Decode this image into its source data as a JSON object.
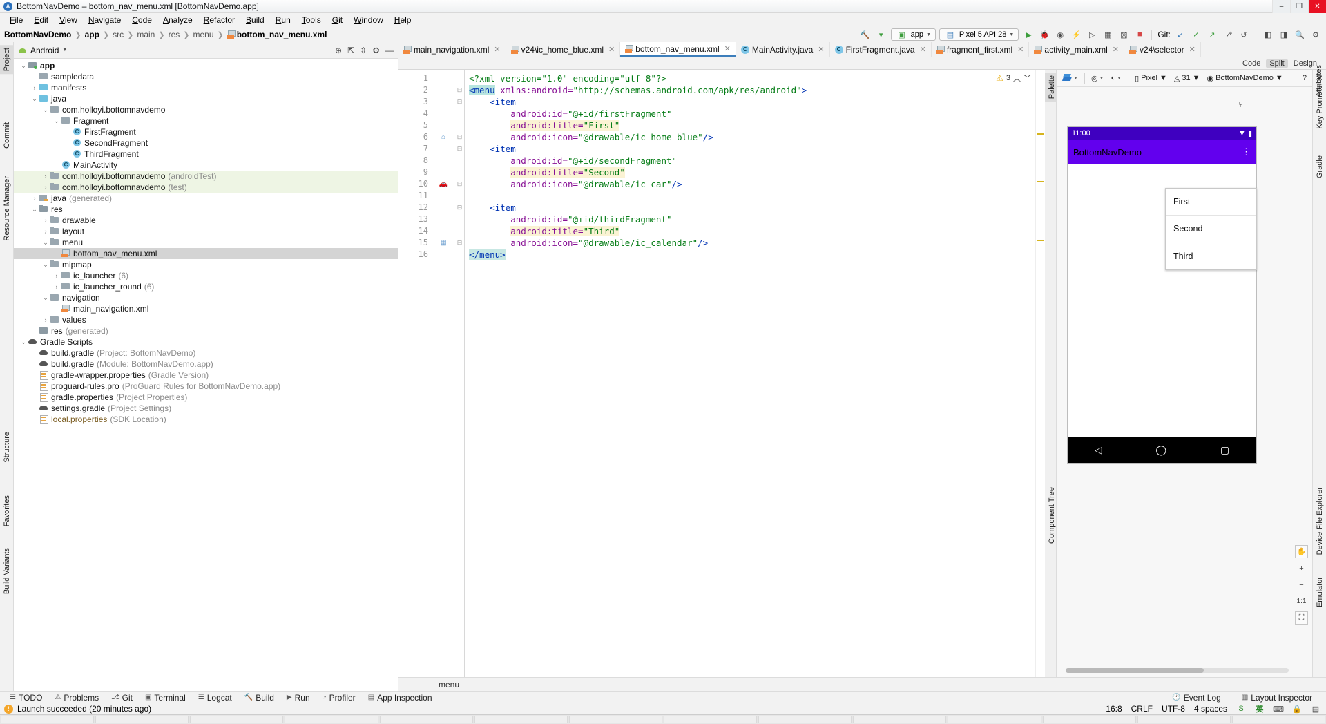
{
  "window": {
    "title": "BottomNavDemo – bottom_nav_menu.xml [BottomNavDemo.app]",
    "app_icon": "android-studio-icon",
    "minimize": "–",
    "maximize": "❐",
    "close": "✕"
  },
  "menubar": [
    "File",
    "Edit",
    "View",
    "Navigate",
    "Code",
    "Analyze",
    "Refactor",
    "Build",
    "Run",
    "Tools",
    "Git",
    "Window",
    "Help"
  ],
  "breadcrumb": {
    "project": "BottomNavDemo",
    "items": [
      "app",
      "src",
      "main",
      "res",
      "menu"
    ],
    "file": "bottom_nav_menu.xml"
  },
  "main_toolbar": {
    "module_selector": "app",
    "device_selector": "Pixel 5 API 28",
    "git_label": "Git:",
    "icons": [
      "build-hammer-icon",
      "run-icon",
      "debug-icon",
      "profile-icon",
      "attach-debugger-icon",
      "sdk-manager-icon",
      "avd-manager-icon",
      "stop-icon",
      "check-icon",
      "update-icon",
      "push-icon",
      "history-icon",
      "search-everywhere-icon",
      "settings-icon"
    ]
  },
  "project_panel": {
    "header_title": "Android",
    "header_icons": [
      "locate-icon",
      "collapse-all-icon",
      "filter-icon",
      "settings-icon",
      "hide-icon"
    ],
    "tree": [
      {
        "depth": 0,
        "arrow": "v",
        "icon": "app",
        "label": "app",
        "suffix": "",
        "bold": true
      },
      {
        "depth": 1,
        "arrow": "",
        "icon": "folder",
        "label": "sampledata",
        "suffix": ""
      },
      {
        "depth": 1,
        "arrow": ">",
        "icon": "folderb",
        "label": "manifests",
        "suffix": ""
      },
      {
        "depth": 1,
        "arrow": "v",
        "icon": "folderb",
        "label": "java",
        "suffix": ""
      },
      {
        "depth": 2,
        "arrow": "v",
        "icon": "folder",
        "label": "com.holloyi.bottomnavdemo",
        "suffix": ""
      },
      {
        "depth": 3,
        "arrow": "v",
        "icon": "folder",
        "label": "Fragment",
        "suffix": ""
      },
      {
        "depth": 4,
        "arrow": "",
        "icon": "cls",
        "label": "FirstFragment",
        "suffix": ""
      },
      {
        "depth": 4,
        "arrow": "",
        "icon": "cls",
        "label": "SecondFragment",
        "suffix": ""
      },
      {
        "depth": 4,
        "arrow": "",
        "icon": "cls",
        "label": "ThirdFragment",
        "suffix": ""
      },
      {
        "depth": 3,
        "arrow": "",
        "icon": "cls",
        "label": "MainActivity",
        "suffix": ""
      },
      {
        "depth": 2,
        "arrow": ">",
        "icon": "folder",
        "label": "com.holloyi.bottomnavdemo",
        "suffix": "(androidTest)",
        "row": "test"
      },
      {
        "depth": 2,
        "arrow": ">",
        "icon": "folder",
        "label": "com.holloyi.bottomnavdemo",
        "suffix": "(test)",
        "row": "test"
      },
      {
        "depth": 1,
        "arrow": ">",
        "icon": "gen",
        "label": "java",
        "suffix": "(generated)"
      },
      {
        "depth": 1,
        "arrow": "v",
        "icon": "res",
        "label": "res",
        "suffix": ""
      },
      {
        "depth": 2,
        "arrow": ">",
        "icon": "folder",
        "label": "drawable",
        "suffix": ""
      },
      {
        "depth": 2,
        "arrow": ">",
        "icon": "folder",
        "label": "layout",
        "suffix": ""
      },
      {
        "depth": 2,
        "arrow": "v",
        "icon": "folder",
        "label": "menu",
        "suffix": ""
      },
      {
        "depth": 3,
        "arrow": "",
        "icon": "xml",
        "label": "bottom_nav_menu.xml",
        "suffix": "",
        "row": "sel"
      },
      {
        "depth": 2,
        "arrow": "v",
        "icon": "folder",
        "label": "mipmap",
        "suffix": ""
      },
      {
        "depth": 3,
        "arrow": ">",
        "icon": "folder",
        "label": "ic_launcher",
        "suffix": "(6)"
      },
      {
        "depth": 3,
        "arrow": ">",
        "icon": "folder",
        "label": "ic_launcher_round",
        "suffix": "(6)"
      },
      {
        "depth": 2,
        "arrow": "v",
        "icon": "folder",
        "label": "navigation",
        "suffix": ""
      },
      {
        "depth": 3,
        "arrow": "",
        "icon": "xml",
        "label": "main_navigation.xml",
        "suffix": ""
      },
      {
        "depth": 2,
        "arrow": ">",
        "icon": "folder",
        "label": "values",
        "suffix": ""
      },
      {
        "depth": 1,
        "arrow": "",
        "icon": "res",
        "label": "res",
        "suffix": "(generated)"
      },
      {
        "depth": 0,
        "arrow": "v",
        "icon": "gradle",
        "label": "Gradle Scripts",
        "suffix": ""
      },
      {
        "depth": 1,
        "arrow": "",
        "icon": "gradle",
        "label": "build.gradle",
        "suffix": "(Project: BottomNavDemo)"
      },
      {
        "depth": 1,
        "arrow": "",
        "icon": "gradle",
        "label": "build.gradle",
        "suffix": "(Module: BottomNavDemo.app)"
      },
      {
        "depth": 1,
        "arrow": "",
        "icon": "props",
        "label": "gradle-wrapper.properties",
        "suffix": "(Gradle Version)"
      },
      {
        "depth": 1,
        "arrow": "",
        "icon": "props",
        "label": "proguard-rules.pro",
        "suffix": "(ProGuard Rules for BottomNavDemo.app)"
      },
      {
        "depth": 1,
        "arrow": "",
        "icon": "props",
        "label": "gradle.properties",
        "suffix": "(Project Properties)"
      },
      {
        "depth": 1,
        "arrow": "",
        "icon": "gradle",
        "label": "settings.gradle",
        "suffix": "(Project Settings)"
      },
      {
        "depth": 1,
        "arrow": "",
        "icon": "props",
        "label": "local.properties",
        "suffix": "(SDK Location)",
        "link": true
      }
    ]
  },
  "left_strip": [
    "Project",
    "Commit",
    "Resource Manager",
    "Structure",
    "Favorites",
    "Build Variants"
  ],
  "right_strip": [
    "Key Promoter X",
    "Gradle",
    "Attributes",
    "Device File Explorer",
    "Emulator"
  ],
  "editor_tabs": [
    {
      "label": "main_navigation.xml",
      "icon": "xml-file-icon",
      "active": false
    },
    {
      "label": "v24\\ic_home_blue.xml",
      "icon": "xml-file-icon",
      "active": false
    },
    {
      "label": "bottom_nav_menu.xml",
      "icon": "xml-file-icon",
      "active": true
    },
    {
      "label": "MainActivity.java",
      "icon": "java-class-icon",
      "active": false
    },
    {
      "label": "FirstFragment.java",
      "icon": "java-class-icon",
      "active": false
    },
    {
      "label": "fragment_first.xml",
      "icon": "xml-file-icon",
      "active": false
    },
    {
      "label": "activity_main.xml",
      "icon": "xml-file-icon",
      "active": false
    },
    {
      "label": "v24\\selector",
      "icon": "xml-file-icon",
      "active": false
    }
  ],
  "view_modes": [
    {
      "label": "Code",
      "selected": false
    },
    {
      "label": "Split",
      "selected": true
    },
    {
      "label": "Design",
      "selected": false
    }
  ],
  "inspection": {
    "warning_count": "3",
    "warning_icon": "warning-triangle-icon"
  },
  "code": {
    "line_numbers": [
      "1",
      "2",
      "3",
      "4",
      "5",
      "6",
      "7",
      "8",
      "9",
      "10",
      "11",
      "12",
      "13",
      "14",
      "15",
      "16"
    ],
    "lines": [
      {
        "n": 1,
        "segs": [
          {
            "t": "<?xml version=\"1.0\" encoding=\"utf-8\"?>",
            "c": "cl-pi"
          }
        ]
      },
      {
        "n": 2,
        "segs": [
          {
            "t": "<menu",
            "c": "cl-tag selhl"
          },
          {
            "t": " xmlns:android=",
            "c": "cl-attr"
          },
          {
            "t": "\"http://schemas.android.com/apk/res/android\"",
            "c": "cl-str"
          },
          {
            "t": ">",
            "c": "cl-tag"
          }
        ]
      },
      {
        "n": 3,
        "segs": [
          {
            "t": "    <item",
            "c": "cl-tag"
          }
        ]
      },
      {
        "n": 4,
        "segs": [
          {
            "t": "        android:id=",
            "c": "cl-attr"
          },
          {
            "t": "\"@+id/firstFragment\"",
            "c": "cl-str"
          }
        ]
      },
      {
        "n": 5,
        "segs": [
          {
            "t": "        ",
            "c": ""
          },
          {
            "t": "android:title=",
            "c": "cl-attr hl"
          },
          {
            "t": "\"First\"",
            "c": "cl-str hl"
          }
        ]
      },
      {
        "n": 6,
        "segs": [
          {
            "t": "        android:icon=",
            "c": "cl-attr"
          },
          {
            "t": "\"@drawable/ic_home_blue\"",
            "c": "cl-str"
          },
          {
            "t": "/>",
            "c": "cl-tag"
          }
        ]
      },
      {
        "n": 7,
        "segs": [
          {
            "t": "    <item",
            "c": "cl-tag"
          }
        ]
      },
      {
        "n": 8,
        "segs": [
          {
            "t": "        android:id=",
            "c": "cl-attr"
          },
          {
            "t": "\"@+id/secondFragment\"",
            "c": "cl-str"
          }
        ]
      },
      {
        "n": 9,
        "segs": [
          {
            "t": "        ",
            "c": ""
          },
          {
            "t": "android:title=",
            "c": "cl-attr hl"
          },
          {
            "t": "\"Second\"",
            "c": "cl-str hl"
          }
        ]
      },
      {
        "n": 10,
        "segs": [
          {
            "t": "        android:icon=",
            "c": "cl-attr"
          },
          {
            "t": "\"@drawable/ic_car\"",
            "c": "cl-str"
          },
          {
            "t": "/>",
            "c": "cl-tag"
          }
        ]
      },
      {
        "n": 11,
        "segs": [
          {
            "t": "",
            "c": ""
          }
        ]
      },
      {
        "n": 12,
        "segs": [
          {
            "t": "    <item",
            "c": "cl-tag"
          }
        ]
      },
      {
        "n": 13,
        "segs": [
          {
            "t": "        android:id=",
            "c": "cl-attr"
          },
          {
            "t": "\"@+id/thirdFragment\"",
            "c": "cl-str"
          }
        ]
      },
      {
        "n": 14,
        "segs": [
          {
            "t": "        ",
            "c": ""
          },
          {
            "t": "android:title=",
            "c": "cl-attr hl"
          },
          {
            "t": "\"Third\"",
            "c": "cl-str hl"
          }
        ]
      },
      {
        "n": 15,
        "segs": [
          {
            "t": "        android:icon=",
            "c": "cl-attr"
          },
          {
            "t": "\"@drawable/ic_calendar\"",
            "c": "cl-str"
          },
          {
            "t": "/>",
            "c": "cl-tag"
          }
        ]
      },
      {
        "n": 16,
        "segs": [
          {
            "t": "</menu>",
            "c": "cl-tag caret-blk"
          }
        ]
      }
    ],
    "gutter_marks": [
      {
        "line": 6,
        "icon": "home-icon"
      },
      {
        "line": 10,
        "icon": "car-icon"
      },
      {
        "line": 15,
        "icon": "calendar-icon"
      }
    ],
    "breadcrumb_status": "menu"
  },
  "design": {
    "toolbar": {
      "design_surface": "layers-icon",
      "orientation": "orientation-icon",
      "theme": "theme-icon",
      "device": "Pixel",
      "api": "31",
      "theme_name": "BottomNavDemo",
      "help_icon": "help-icon",
      "palette_label": "Palette",
      "component_tree_label": "Component Tree"
    },
    "phone": {
      "status_time": "11:00",
      "status_icons": [
        "wifi-icon",
        "battery-icon"
      ],
      "app_title": "BottomNavDemo",
      "overflow_icon": "overflow-menu-icon",
      "overflow_items": [
        "First",
        "Second",
        "Third"
      ],
      "nav_back": "◁",
      "nav_home": "◯",
      "nav_recents": "▢"
    },
    "zoom_controls": {
      "pan": "pan-icon",
      "zoom_in": "+",
      "zoom_out": "−",
      "zoom_fit": "1:1",
      "zoom_to_fit": "fit-icon"
    }
  },
  "bottom_tool_windows": [
    {
      "label": "TODO",
      "icon": "todo-icon"
    },
    {
      "label": "Problems",
      "icon": "problems-icon"
    },
    {
      "label": "Git",
      "icon": "git-icon"
    },
    {
      "label": "Terminal",
      "icon": "terminal-icon"
    },
    {
      "label": "Logcat",
      "icon": "logcat-icon"
    },
    {
      "label": "Build",
      "icon": "build-icon"
    },
    {
      "label": "Run",
      "icon": "run-icon"
    },
    {
      "label": "Profiler",
      "icon": "profiler-icon"
    },
    {
      "label": "App Inspection",
      "icon": "app-inspection-icon"
    }
  ],
  "bottom_right_tools": [
    {
      "label": "Event Log",
      "icon": "event-log-icon"
    },
    {
      "label": "Layout Inspector",
      "icon": "layout-inspector-icon"
    }
  ],
  "statusbar": {
    "message": "Launch succeeded (20 minutes ago)",
    "badge_icon": "run-status-icon",
    "caret": "16:8",
    "line_sep": "CRLF",
    "encoding": "UTF-8",
    "indent": "4 spaces",
    "ime": "英",
    "icons": [
      "sogou-icon",
      "keyboard-icon",
      "lock-icon",
      "notifications-icon"
    ]
  },
  "colors": {
    "accent_blue": "#3d7ebb",
    "tag_blue": "#0033b3",
    "attr_purple": "#871094",
    "string_green": "#067d17",
    "highlight_yellow": "#fbf3d4",
    "purple_appbar": "#6200ee",
    "status_purple": "#3f00c0",
    "warn_yellow": "#e8b21d"
  }
}
